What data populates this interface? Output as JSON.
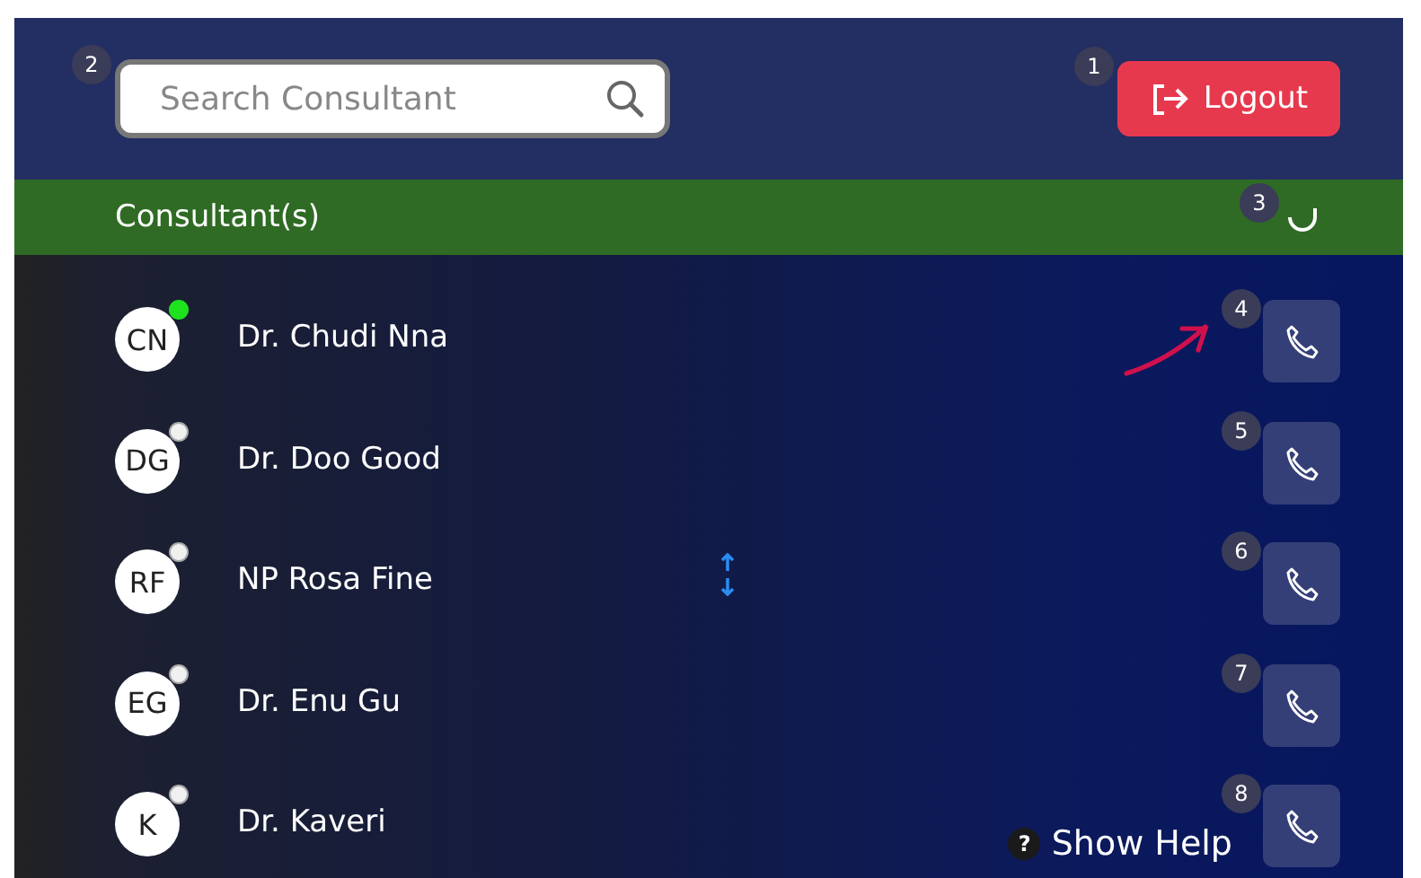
{
  "header": {
    "search": {
      "placeholder": "Search Consultant",
      "badge": "2"
    },
    "logout": {
      "label": "Logout",
      "badge": "1"
    }
  },
  "section": {
    "title": "Consultant(s)",
    "refresh_badge": "3"
  },
  "consultants": [
    {
      "initials": "CN",
      "name": "Dr. Chudi Nna",
      "online": true,
      "badge": "4"
    },
    {
      "initials": "DG",
      "name": "Dr. Doo Good",
      "online": false,
      "badge": "5"
    },
    {
      "initials": "RF",
      "name": "NP Rosa Fine",
      "online": false,
      "badge": "6"
    },
    {
      "initials": "EG",
      "name": "Dr. Enu Gu",
      "online": false,
      "badge": "7"
    },
    {
      "initials": "K",
      "name": "Dr. Kaveri",
      "online": false,
      "badge": "8"
    }
  ],
  "help": {
    "icon": "?",
    "label": "Show Help"
  }
}
